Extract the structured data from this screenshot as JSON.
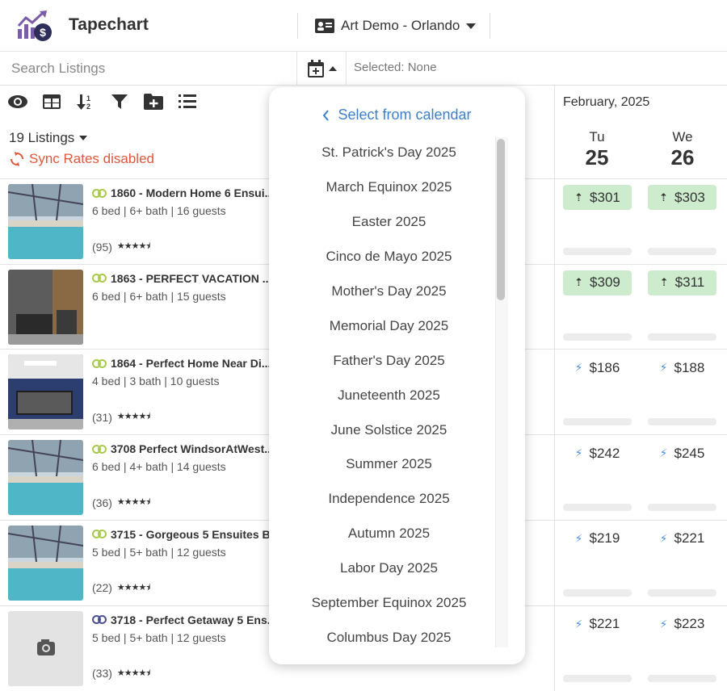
{
  "header": {
    "app_title": "Tapechart",
    "account_label": "Art Demo - Orlando"
  },
  "search": {
    "placeholder": "Search Listings",
    "selected_label": "Selected: None"
  },
  "listings_summary": {
    "count_label": "19 Listings",
    "sync_label": "Sync Rates disabled"
  },
  "calendar": {
    "month_label": "February, 2025",
    "days": [
      {
        "name": "Tu",
        "num": "25"
      },
      {
        "name": "We",
        "num": "26"
      }
    ]
  },
  "listings": [
    {
      "title": "1860 - Modern Home 6 Ensui...",
      "specs": "6 bed | 6+ bath | 16 guests",
      "reviews": "(95)",
      "stars": 4.5,
      "thumb": "pool",
      "link_color": "#a8c94a",
      "prices": [
        {
          "value": "$301",
          "style": "green"
        },
        {
          "value": "$303",
          "style": "green"
        }
      ]
    },
    {
      "title": "1863 - PERFECT VACATION ...",
      "specs": "6 bed | 6+ bath | 15 guests",
      "reviews": "",
      "stars": 0,
      "thumb": "living",
      "link_color": "#a8c94a",
      "prices": [
        {
          "value": "$309",
          "style": "green"
        },
        {
          "value": "$311",
          "style": "green"
        }
      ]
    },
    {
      "title": "1864 - Perfect Home Near Di...",
      "specs": "4 bed | 3 bath | 10 guests",
      "reviews": "(31)",
      "stars": 4.5,
      "thumb": "game",
      "link_color": "#a8c94a",
      "prices": [
        {
          "value": "$186",
          "style": "bolt"
        },
        {
          "value": "$188",
          "style": "bolt"
        }
      ]
    },
    {
      "title": "3708 Perfect WindsorAtWest...",
      "specs": "6 bed | 4+ bath | 14 guests",
      "reviews": "(36)",
      "stars": 4.5,
      "thumb": "pool",
      "link_color": "#a8c94a",
      "prices": [
        {
          "value": "$242",
          "style": "bolt"
        },
        {
          "value": "$245",
          "style": "bolt"
        }
      ]
    },
    {
      "title": "3715 - Gorgeous 5 Ensuites B...",
      "specs": "5 bed | 5+ bath | 12 guests",
      "reviews": "(22)",
      "stars": 4.5,
      "thumb": "pool",
      "link_color": "#a8c94a",
      "prices": [
        {
          "value": "$219",
          "style": "bolt"
        },
        {
          "value": "$221",
          "style": "bolt"
        }
      ]
    },
    {
      "title": "3718 - Perfect Getaway 5 Ens...",
      "specs": "5 bed | 5+ bath | 12 guests",
      "reviews": "(33)",
      "stars": 4.5,
      "thumb": "placeholder",
      "link_color": "#4a4f8f",
      "prices": [
        {
          "value": "$221",
          "style": "bolt"
        },
        {
          "value": "$223",
          "style": "bolt"
        }
      ]
    }
  ],
  "dropdown": {
    "back_label": "Select from calendar",
    "items": [
      "St. Patrick's Day 2025",
      "March Equinox 2025",
      "Easter 2025",
      "Cinco de Mayo 2025",
      "Mother's Day 2025",
      "Memorial Day 2025",
      "Father's Day 2025",
      "Juneteenth 2025",
      "June Solstice 2025",
      "Summer 2025",
      "Independence 2025",
      "Autumn 2025",
      "Labor Day 2025",
      "September Equinox 2025",
      "Columbus Day 2025"
    ]
  },
  "colors": {
    "accent_blue": "#3d7fc9",
    "sync_red": "#e0573c",
    "price_green_bg": "#cdebcd",
    "logo_purple": "#7b5ca8"
  }
}
